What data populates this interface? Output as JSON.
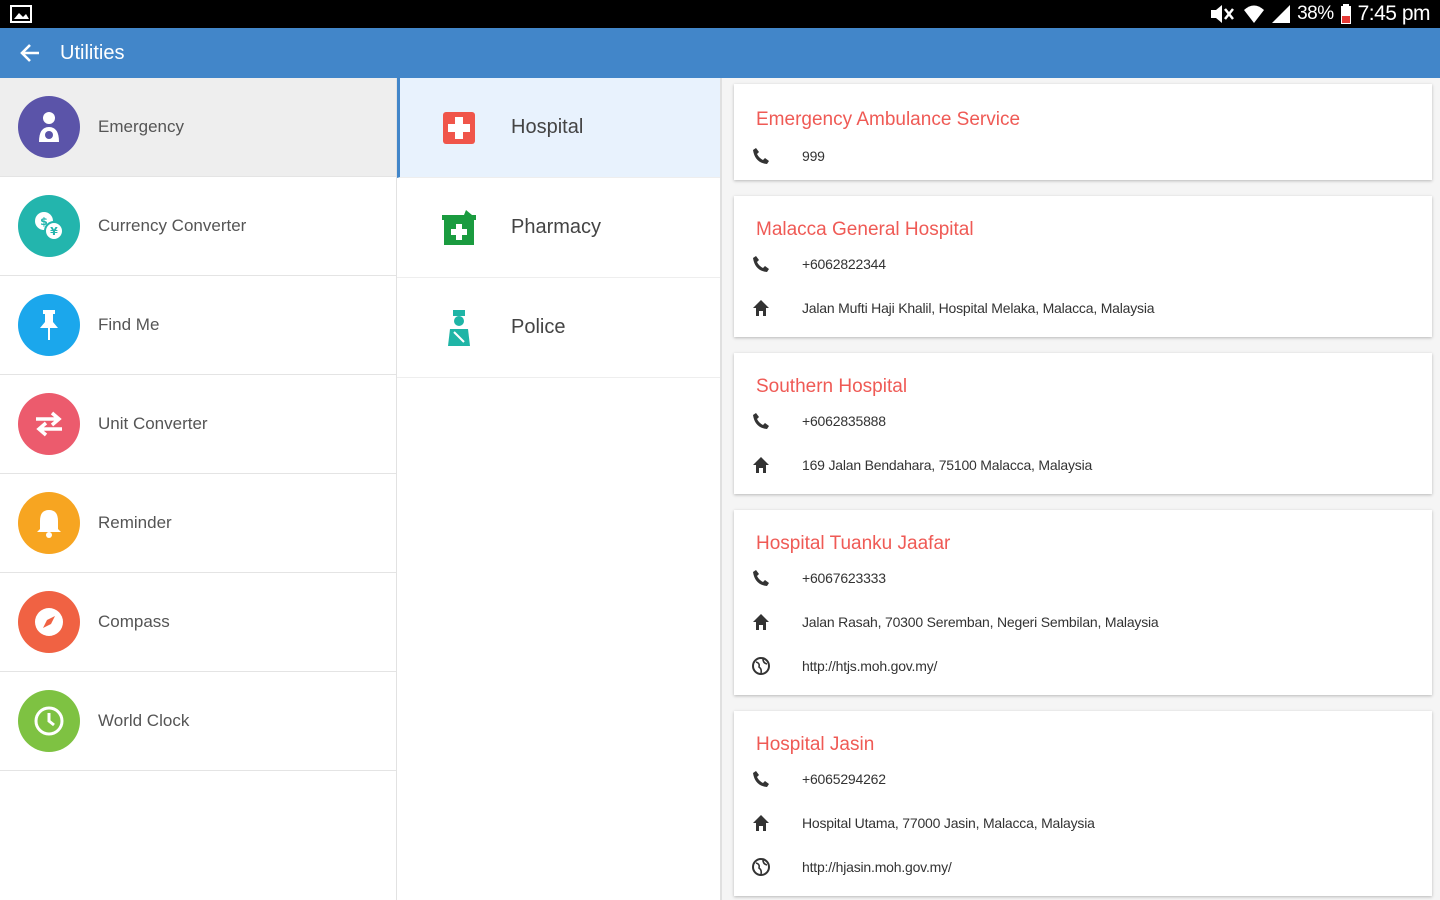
{
  "status_bar": {
    "battery": "38%",
    "time": "7:45 pm",
    "icons": [
      "gallery-icon",
      "mute-icon",
      "wifi-icon",
      "signal-icon",
      "battery-icon"
    ]
  },
  "app_bar": {
    "title": "Utilities",
    "back_icon": "arrow-back-icon",
    "color": "#4286c9"
  },
  "utilities": [
    {
      "label": "Emergency",
      "icon": "person-icon",
      "color": "#5b54a9",
      "active": true
    },
    {
      "label": "Currency Converter",
      "icon": "currency-icon",
      "color": "#23b5ad"
    },
    {
      "label": "Find Me",
      "icon": "pin-icon",
      "color": "#1ba7ec"
    },
    {
      "label": "Unit Converter",
      "icon": "swap-icon",
      "color": "#ec5b6d"
    },
    {
      "label": "Reminder",
      "icon": "bell-icon",
      "color": "#f7a521"
    },
    {
      "label": "Compass",
      "icon": "compass-icon",
      "color": "#f06243"
    },
    {
      "label": "World Clock",
      "icon": "clock-icon",
      "color": "#7ec242"
    }
  ],
  "categories": [
    {
      "label": "Hospital",
      "icon": "hospital-icon",
      "color": "#f0554a",
      "active": true
    },
    {
      "label": "Pharmacy",
      "icon": "pharmacy-icon",
      "color": "#1a9b3f"
    },
    {
      "label": "Police",
      "icon": "police-icon",
      "color": "#1fb5a6"
    }
  ],
  "contacts": [
    {
      "name": "Emergency Ambulance Service",
      "phone": "999"
    },
    {
      "name": "Malacca General Hospital",
      "phone": "+6062822344",
      "address": "Jalan Mufti Haji Khalil, Hospital Melaka, Malacca, Malaysia"
    },
    {
      "name": "Southern Hospital",
      "phone": "+6062835888",
      "address": "169 Jalan Bendahara, 75100 Malacca, Malaysia"
    },
    {
      "name": "Hospital Tuanku Jaafar",
      "phone": "+6067623333",
      "address": "Jalan Rasah, 70300 Seremban, Negeri Sembilan, Malaysia",
      "website": "http://htjs.moh.gov.my/"
    },
    {
      "name": "Hospital Jasin",
      "phone": "+6065294262",
      "address": "Hospital Utama, 77000 Jasin, Malacca, Malaysia",
      "website": "http://hjasin.moh.gov.my/"
    }
  ],
  "colors": {
    "accent": "#ef5a55",
    "appbar": "#4286c9"
  }
}
